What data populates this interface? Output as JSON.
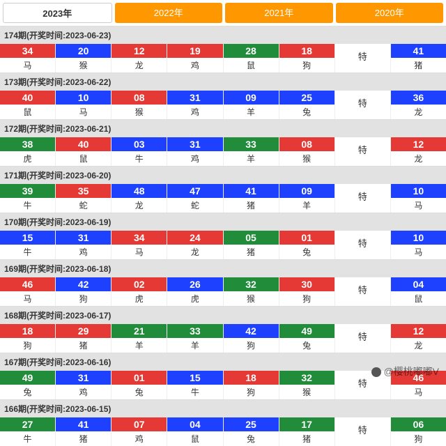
{
  "tabs": [
    "2023年",
    "2022年",
    "2021年",
    "2020年"
  ],
  "active_tab": 0,
  "special_label": "特",
  "periods": [
    {
      "header": "174期(开奖时间:2023-06-23)",
      "balls": [
        {
          "n": "34",
          "z": "马",
          "c": "red"
        },
        {
          "n": "20",
          "z": "猴",
          "c": "blue"
        },
        {
          "n": "12",
          "z": "龙",
          "c": "red"
        },
        {
          "n": "19",
          "z": "鸡",
          "c": "red"
        },
        {
          "n": "28",
          "z": "鼠",
          "c": "green"
        },
        {
          "n": "18",
          "z": "狗",
          "c": "red"
        }
      ],
      "special": {
        "n": "41",
        "z": "猪",
        "c": "blue"
      }
    },
    {
      "header": "173期(开奖时间:2023-06-22)",
      "balls": [
        {
          "n": "40",
          "z": "鼠",
          "c": "red"
        },
        {
          "n": "10",
          "z": "马",
          "c": "blue"
        },
        {
          "n": "08",
          "z": "猴",
          "c": "red"
        },
        {
          "n": "31",
          "z": "鸡",
          "c": "blue"
        },
        {
          "n": "09",
          "z": "羊",
          "c": "blue"
        },
        {
          "n": "25",
          "z": "兔",
          "c": "blue"
        }
      ],
      "special": {
        "n": "36",
        "z": "龙",
        "c": "blue"
      }
    },
    {
      "header": "172期(开奖时间:2023-06-21)",
      "balls": [
        {
          "n": "38",
          "z": "虎",
          "c": "green"
        },
        {
          "n": "40",
          "z": "鼠",
          "c": "red"
        },
        {
          "n": "03",
          "z": "牛",
          "c": "blue"
        },
        {
          "n": "31",
          "z": "鸡",
          "c": "blue"
        },
        {
          "n": "33",
          "z": "羊",
          "c": "green"
        },
        {
          "n": "08",
          "z": "猴",
          "c": "red"
        }
      ],
      "special": {
        "n": "12",
        "z": "龙",
        "c": "red"
      }
    },
    {
      "header": "171期(开奖时间:2023-06-20)",
      "balls": [
        {
          "n": "39",
          "z": "牛",
          "c": "green"
        },
        {
          "n": "35",
          "z": "蛇",
          "c": "red"
        },
        {
          "n": "48",
          "z": "龙",
          "c": "blue"
        },
        {
          "n": "47",
          "z": "蛇",
          "c": "blue"
        },
        {
          "n": "41",
          "z": "猪",
          "c": "blue"
        },
        {
          "n": "09",
          "z": "羊",
          "c": "blue"
        }
      ],
      "special": {
        "n": "10",
        "z": "马",
        "c": "blue"
      }
    },
    {
      "header": "170期(开奖时间:2023-06-19)",
      "balls": [
        {
          "n": "15",
          "z": "牛",
          "c": "blue"
        },
        {
          "n": "31",
          "z": "鸡",
          "c": "blue"
        },
        {
          "n": "34",
          "z": "马",
          "c": "red"
        },
        {
          "n": "24",
          "z": "龙",
          "c": "red"
        },
        {
          "n": "05",
          "z": "猪",
          "c": "green"
        },
        {
          "n": "01",
          "z": "兔",
          "c": "red"
        }
      ],
      "special": {
        "n": "10",
        "z": "马",
        "c": "blue"
      }
    },
    {
      "header": "169期(开奖时间:2023-06-18)",
      "balls": [
        {
          "n": "46",
          "z": "马",
          "c": "red"
        },
        {
          "n": "42",
          "z": "狗",
          "c": "blue"
        },
        {
          "n": "02",
          "z": "虎",
          "c": "red"
        },
        {
          "n": "26",
          "z": "虎",
          "c": "blue"
        },
        {
          "n": "32",
          "z": "猴",
          "c": "green"
        },
        {
          "n": "30",
          "z": "狗",
          "c": "red"
        }
      ],
      "special": {
        "n": "04",
        "z": "鼠",
        "c": "blue"
      }
    },
    {
      "header": "168期(开奖时间:2023-06-17)",
      "balls": [
        {
          "n": "18",
          "z": "狗",
          "c": "red"
        },
        {
          "n": "29",
          "z": "猪",
          "c": "red"
        },
        {
          "n": "21",
          "z": "羊",
          "c": "green"
        },
        {
          "n": "33",
          "z": "羊",
          "c": "green"
        },
        {
          "n": "42",
          "z": "狗",
          "c": "blue"
        },
        {
          "n": "49",
          "z": "兔",
          "c": "green"
        }
      ],
      "special": {
        "n": "12",
        "z": "龙",
        "c": "red"
      }
    },
    {
      "header": "167期(开奖时间:2023-06-16)",
      "balls": [
        {
          "n": "49",
          "z": "兔",
          "c": "green"
        },
        {
          "n": "31",
          "z": "鸡",
          "c": "blue"
        },
        {
          "n": "01",
          "z": "兔",
          "c": "red"
        },
        {
          "n": "15",
          "z": "牛",
          "c": "blue"
        },
        {
          "n": "18",
          "z": "狗",
          "c": "red"
        },
        {
          "n": "32",
          "z": "猴",
          "c": "green"
        }
      ],
      "special": {
        "n": "46",
        "z": "马",
        "c": "red"
      }
    },
    {
      "header": "166期(开奖时间:2023-06-15)",
      "balls": [
        {
          "n": "27",
          "z": "牛",
          "c": "green"
        },
        {
          "n": "41",
          "z": "猪",
          "c": "blue"
        },
        {
          "n": "07",
          "z": "鸡",
          "c": "red"
        },
        {
          "n": "04",
          "z": "鼠",
          "c": "blue"
        },
        {
          "n": "25",
          "z": "兔",
          "c": "blue"
        },
        {
          "n": "17",
          "z": "猪",
          "c": "green"
        }
      ],
      "special": {
        "n": "06",
        "z": "狗",
        "c": "green"
      }
    }
  ],
  "watermark": "@樱桃嘟嘟V"
}
